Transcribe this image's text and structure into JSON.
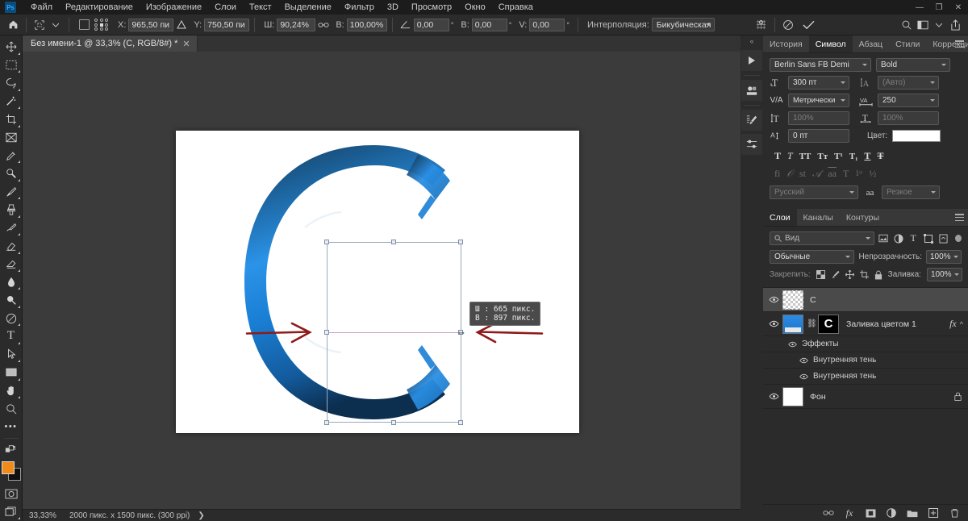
{
  "app": {
    "logo": "Ps",
    "menus": [
      "Файл",
      "Редактирование",
      "Изображение",
      "Слои",
      "Текст",
      "Выделение",
      "Фильтр",
      "3D",
      "Просмотр",
      "Окно",
      "Справка"
    ],
    "window_controls": [
      "minimize",
      "restore",
      "close"
    ]
  },
  "options_bar": {
    "home_icon": "home-icon",
    "tool_icon": "free-transform-icon",
    "ref_point_label": "reference-point-toggle",
    "x_label": "X:",
    "x_value": "965,50 пи",
    "delta_icon": "delta-icon",
    "y_label": "Y:",
    "y_value": "750,50 пи",
    "w_label": "Ш:",
    "w_value": "90,24%",
    "link_icon": "link-icon",
    "h_label": "В:",
    "h_value": "100,00%",
    "angle_label": "angle-icon",
    "angle_value": "0,00",
    "skew_h_label": "B:",
    "skew_h_value": "0,00",
    "skew_v_label": "V:",
    "skew_v_value": "0,00",
    "interp_label": "Интерполяция:",
    "interp_value": "Бикубическая",
    "degree": "°",
    "warp_icon": "warp-icon",
    "cancel_icon": "cancel-transform-icon",
    "commit_icon": "commit-transform-icon",
    "search_icon": "search-icon",
    "workspace_icon": "workspace-icon",
    "share_icon": "share-icon"
  },
  "toolbar": {
    "tools": [
      {
        "name": "move-tool",
        "glyph": "✥",
        "sub": true
      },
      {
        "name": "rectangular-marquee-tool",
        "glyph": "▭",
        "sub": true
      },
      {
        "name": "lasso-tool",
        "glyph": "◯",
        "sub": true
      },
      {
        "name": "magic-wand-tool",
        "glyph": "✨",
        "sub": true
      },
      {
        "name": "crop-tool",
        "glyph": "⌗",
        "sub": true
      },
      {
        "name": "frame-tool",
        "glyph": "⊠",
        "sub": false
      },
      {
        "name": "eyedropper-tool",
        "glyph": "✑",
        "sub": true
      },
      {
        "name": "spot-healing-brush-tool",
        "glyph": "⊘",
        "sub": true
      },
      {
        "name": "brush-tool",
        "glyph": "✎",
        "sub": true
      },
      {
        "name": "clone-stamp-tool",
        "glyph": "⎙",
        "sub": true
      },
      {
        "name": "history-brush-tool",
        "glyph": "↺",
        "sub": true
      },
      {
        "name": "eraser-tool",
        "glyph": "◻",
        "sub": true
      },
      {
        "name": "gradient-tool",
        "glyph": "▨",
        "sub": true
      },
      {
        "name": "blur-tool",
        "glyph": "💧",
        "sub": true
      },
      {
        "name": "dodge-tool",
        "glyph": "●",
        "sub": true
      },
      {
        "name": "pen-tool",
        "glyph": "✒",
        "sub": true
      },
      {
        "name": "horizontal-type-tool",
        "glyph": "T",
        "sub": true
      },
      {
        "name": "path-selection-tool",
        "glyph": "➤",
        "sub": true
      },
      {
        "name": "rectangle-tool",
        "glyph": "▬",
        "sub": true
      },
      {
        "name": "hand-tool",
        "glyph": "✋",
        "sub": true
      },
      {
        "name": "zoom-tool",
        "glyph": "🔍",
        "sub": false
      },
      {
        "name": "edit-toolbar-button",
        "glyph": "•••",
        "sub": false
      }
    ],
    "swap_colors_icon": "swap-colors-icon",
    "foreground_color": "#f08a1a",
    "background_color": "#111111",
    "quick_mask_icon": "quick-mask-icon",
    "screen_mode_icon": "screen-mode-icon"
  },
  "document": {
    "tab_title": "Без имени-1 @ 33,3% (C, RGB/8#) *",
    "close_icon": "close-tab-icon"
  },
  "canvas": {
    "letter": "C",
    "letter_color": "#1a83df",
    "arrow_color": "#8e1a1a",
    "tooltip": {
      "width_line": "Ш : 665 пикс.",
      "height_line": "В : 897 пикс."
    },
    "cursor": "⇔"
  },
  "status_bar": {
    "zoom": "33,33%",
    "dimensions": "2000 пикс. x 1500 пикс. (300 ppi)",
    "expand": "❯"
  },
  "rail": {
    "collapse_icon": "collapse-panels-icon",
    "buttons": [
      {
        "name": "play-actions-icon",
        "glyph": "▶"
      },
      {
        "name": "libraries-icon",
        "glyph": "▤"
      },
      {
        "name": "brush-settings-icon",
        "glyph": "🖌"
      },
      {
        "name": "adjustments-icon",
        "glyph": "⚙"
      }
    ]
  },
  "character_panel": {
    "tabs": [
      "История",
      "Символ",
      "Абзац",
      "Стили",
      "Коррекция"
    ],
    "selected_tab": "Символ",
    "font_family": "Berlin Sans FB Demi",
    "font_style": "Bold",
    "font_size": "300 пт",
    "leading": "(Авто)",
    "kerning": "Метрически",
    "tracking": "250",
    "vertical_scale": "100%",
    "horizontal_scale": "100%",
    "baseline_shift": "0 пт",
    "color_label": "Цвет:",
    "color_value": "#ffffff",
    "style_buttons": [
      "T",
      "T",
      "TT",
      "Tт",
      "T¹",
      "T₁",
      "T",
      "T"
    ],
    "ot_buttons": [
      "fi",
      "𝒪",
      "st",
      "𝒜",
      "aa",
      "T",
      "1ˢᵗ",
      "½"
    ],
    "language": "Русский",
    "aa_icon": "anti-alias-icon",
    "anti_alias": "Резкое"
  },
  "layers_panel": {
    "tabs": [
      "Слои",
      "Каналы",
      "Контуры"
    ],
    "selected_tab": "Слои",
    "filter_placeholder": "Вид",
    "filter_icons": [
      "pixel-filter-icon",
      "adjustment-filter-icon",
      "type-filter-icon",
      "shape-filter-icon",
      "smart-object-filter-icon"
    ],
    "blend_mode": "Обычные",
    "opacity_label": "Непрозрачность:",
    "opacity_value": "100%",
    "lock_label": "Закрепить:",
    "lock_icons": [
      "lock-transparency-icon",
      "lock-image-icon",
      "lock-position-icon",
      "lock-artboard-icon",
      "lock-all-icon"
    ],
    "fill_label": "Заливка:",
    "fill_value": "100%",
    "layers": [
      {
        "name": "C",
        "thumb": "checker",
        "selected": true,
        "visible": true,
        "has_fx": false,
        "locked": false
      },
      {
        "name": "Заливка цветом 1",
        "thumb": "fill",
        "mask_letter": "C",
        "selected": false,
        "visible": true,
        "has_fx": true,
        "fx_label": "fx",
        "locked": false
      }
    ],
    "effects_group": "Эффекты",
    "effects": [
      "Внутренняя тень",
      "Внутренняя тень"
    ],
    "background_layer": {
      "name": "Фон",
      "visible": true,
      "locked": true
    },
    "footer_icons": [
      "link-layers-icon",
      "add-layer-style-icon",
      "add-layer-mask-icon",
      "new-adjustment-layer-icon",
      "new-group-icon",
      "new-layer-icon",
      "delete-layer-icon"
    ]
  }
}
